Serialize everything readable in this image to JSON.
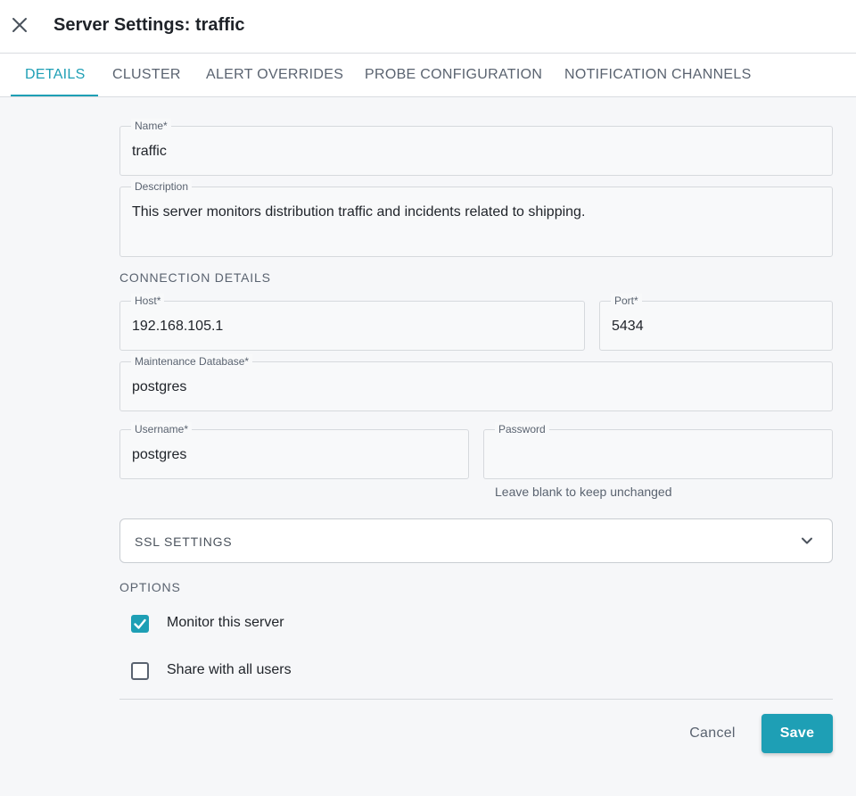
{
  "header": {
    "title": "Server Settings: traffic",
    "close_icon": "close-icon"
  },
  "tabs": [
    {
      "label": "DETAILS",
      "active": true
    },
    {
      "label": "CLUSTER",
      "active": false
    },
    {
      "label": "ALERT OVERRIDES",
      "active": false
    },
    {
      "label": "PROBE CONFIGURATION",
      "active": false
    },
    {
      "label": "NOTIFICATION CHANNELS",
      "active": false
    }
  ],
  "form": {
    "name": {
      "label": "Name",
      "required_mark": "*",
      "value": "traffic"
    },
    "description": {
      "label": "Description",
      "value": "This server monitors distribution traffic and incidents related to shipping."
    },
    "connection_title": "CONNECTION DETAILS",
    "host": {
      "label": "Host",
      "required_mark": "*",
      "value": "192.168.105.1"
    },
    "port": {
      "label": "Port",
      "required_mark": "*",
      "value": "5434"
    },
    "maintenance_db": {
      "label": "Maintenance Database",
      "required_mark": "*",
      "value": "postgres"
    },
    "username": {
      "label": "Username",
      "required_mark": "*",
      "value": "postgres"
    },
    "password": {
      "label": "Password",
      "value": "",
      "helper": "Leave blank to keep unchanged"
    },
    "ssl": {
      "label": "SSL SETTINGS",
      "icon": "chevron-down-icon",
      "expanded": false
    },
    "options_title": "OPTIONS",
    "options": [
      {
        "label": "Monitor this server",
        "checked": true
      },
      {
        "label": "Share with all users",
        "checked": false
      }
    ]
  },
  "actions": {
    "cancel_label": "Cancel",
    "save_label": "Save"
  },
  "colors": {
    "accent": "#1e9fb5",
    "text_primary": "#1f2329",
    "text_secondary": "#5a6370",
    "background": "#f6f7f9"
  }
}
